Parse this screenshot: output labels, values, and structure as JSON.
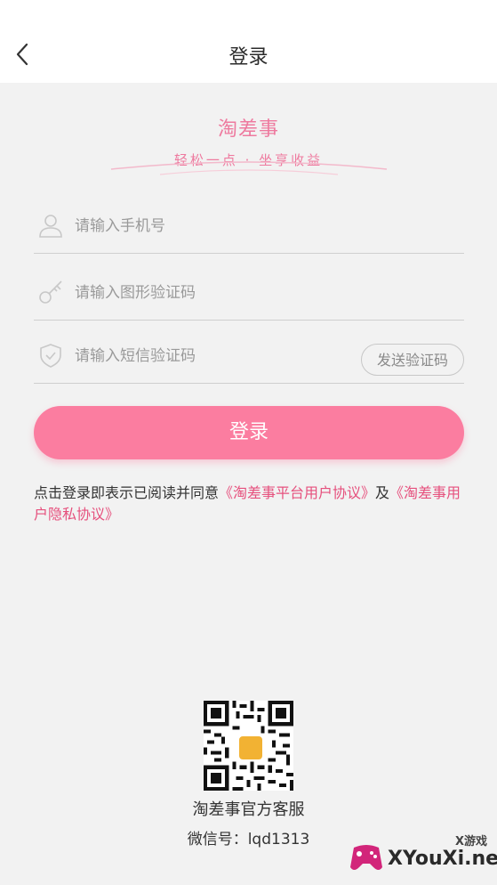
{
  "header": {
    "title": "登录",
    "back_icon": "chevron-left-icon"
  },
  "brand": {
    "name": "淘差事",
    "slogan": "轻松一点 · 坐享收益"
  },
  "form": {
    "phone": {
      "placeholder": "请输入手机号",
      "value": "",
      "icon": "user-icon"
    },
    "captcha": {
      "placeholder": "请输入图形验证码",
      "value": "",
      "icon": "key-icon"
    },
    "sms": {
      "placeholder": "请输入短信验证码",
      "value": "",
      "icon": "shield-check-icon"
    },
    "send_code_label": "发送验证码",
    "login_label": "登录"
  },
  "agreement": {
    "prefix": "点击登录即表示已阅读并同意",
    "link1": "《淘差事平台用户协议》",
    "middle": "及",
    "link2": "《淘差事用户隐私协议》"
  },
  "support": {
    "qr_icon": "qr-code-icon",
    "name": "淘差事官方客服",
    "wechat": "微信号：lqd1313"
  },
  "watermark": {
    "top": "X游戏",
    "main": "XYouXi.net"
  },
  "colors": {
    "accent": "#fb7da0",
    "link": "#e6507d",
    "background": "#f2f2f2"
  }
}
